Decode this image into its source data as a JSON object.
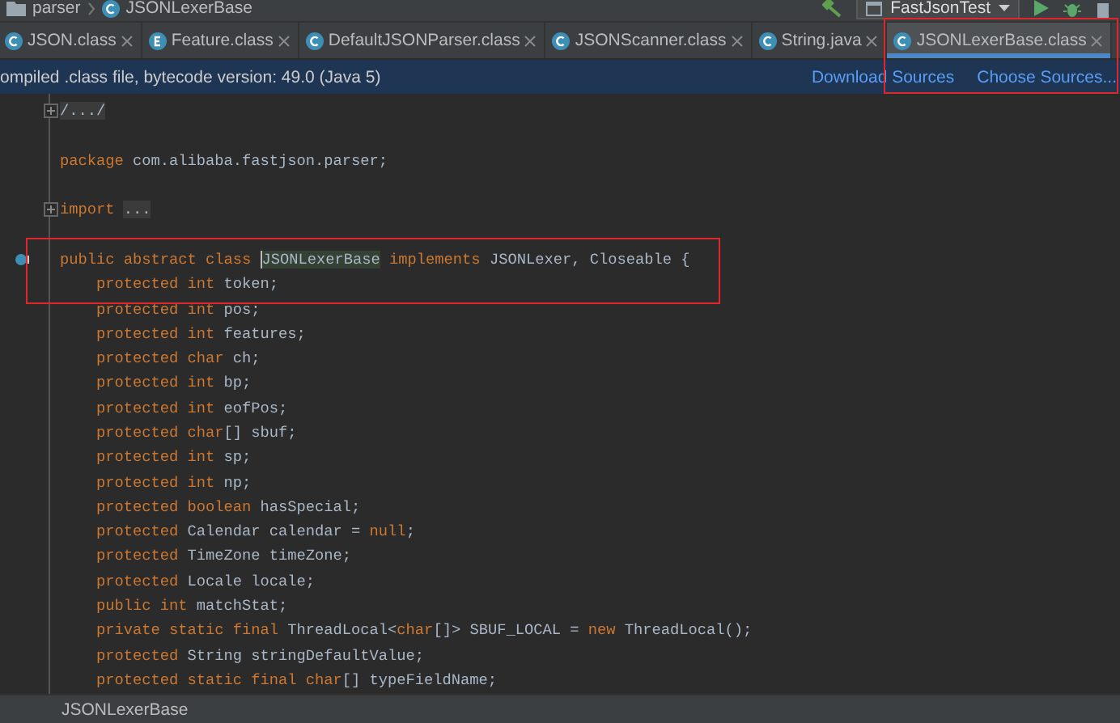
{
  "breadcrumb": [
    {
      "kind": "folder",
      "label": "parser"
    },
    {
      "kind": "class",
      "label": "JSONLexerBase"
    }
  ],
  "run_config": {
    "label": "FastJsonTest"
  },
  "tabs": [
    {
      "label": "JSON.class",
      "kind": "class",
      "selected": false,
      "boxed": false
    },
    {
      "label": "Feature.class",
      "kind": "enum",
      "selected": false,
      "boxed": false
    },
    {
      "label": "DefaultJSONParser.class",
      "kind": "class",
      "selected": false,
      "boxed": false
    },
    {
      "label": "JSONScanner.class",
      "kind": "class",
      "selected": false,
      "boxed": false
    },
    {
      "label": "String.java",
      "kind": "class",
      "selected": false,
      "boxed": false
    },
    {
      "label": "JSONLexerBase.class",
      "kind": "class",
      "selected": true,
      "boxed": true
    }
  ],
  "banner": {
    "text": "ompiled .class file, bytecode version: 49.0 (Java 5)",
    "links": [
      "Download Sources",
      "Choose Sources..."
    ]
  },
  "code_lines": [
    {
      "kind": "code",
      "fold": true,
      "boxed": false,
      "tokens": [
        {
          "text": "/.../",
          "kind": "folded"
        }
      ]
    },
    {
      "kind": "blank"
    },
    {
      "kind": "code",
      "fold": false,
      "boxed": false,
      "tokens": [
        {
          "text": "package",
          "kind": "keyword"
        },
        {
          "text": " com.alibaba.fastjson.parser;",
          "kind": "plain"
        }
      ]
    },
    {
      "kind": "blank"
    },
    {
      "kind": "code",
      "fold": true,
      "boxed": false,
      "tokens": [
        {
          "text": "import ",
          "kind": "keyword"
        },
        {
          "text": "...",
          "kind": "folded"
        }
      ]
    },
    {
      "kind": "blank"
    },
    {
      "kind": "code",
      "fold": false,
      "boxed": true,
      "marker": true,
      "tokens": [
        {
          "text": "public abstract class ",
          "kind": "keyword"
        },
        {
          "text": "JSONLexerBase",
          "kind": "highlight"
        },
        {
          "text": " implements",
          "kind": "keyword"
        },
        {
          "text": " JSONLexer, Closeable {",
          "kind": "plain"
        }
      ]
    },
    {
      "kind": "code",
      "fold": false,
      "boxed": true,
      "tokens": [
        {
          "text": "    protected int",
          "kind": "keyword"
        },
        {
          "text": " token;",
          "kind": "plain"
        }
      ]
    },
    {
      "kind": "code",
      "fold": false,
      "boxed": false,
      "tokens": [
        {
          "text": "    protected int",
          "kind": "keyword"
        },
        {
          "text": " pos;",
          "kind": "plain"
        }
      ]
    },
    {
      "kind": "code",
      "fold": false,
      "boxed": false,
      "tokens": [
        {
          "text": "    protected int",
          "kind": "keyword"
        },
        {
          "text": " features;",
          "kind": "plain"
        }
      ]
    },
    {
      "kind": "code",
      "fold": false,
      "boxed": false,
      "tokens": [
        {
          "text": "    protected char",
          "kind": "keyword"
        },
        {
          "text": " ch;",
          "kind": "plain"
        }
      ]
    },
    {
      "kind": "code",
      "fold": false,
      "boxed": false,
      "tokens": [
        {
          "text": "    protected int",
          "kind": "keyword"
        },
        {
          "text": " bp;",
          "kind": "plain"
        }
      ]
    },
    {
      "kind": "code",
      "fold": false,
      "boxed": false,
      "tokens": [
        {
          "text": "    protected int",
          "kind": "keyword"
        },
        {
          "text": " eofPos;",
          "kind": "plain"
        }
      ]
    },
    {
      "kind": "code",
      "fold": false,
      "boxed": false,
      "tokens": [
        {
          "text": "    protected char",
          "kind": "keyword"
        },
        {
          "text": "[] sbuf;",
          "kind": "plain"
        }
      ]
    },
    {
      "kind": "code",
      "fold": false,
      "boxed": false,
      "tokens": [
        {
          "text": "    protected int",
          "kind": "keyword"
        },
        {
          "text": " sp;",
          "kind": "plain"
        }
      ]
    },
    {
      "kind": "code",
      "fold": false,
      "boxed": false,
      "tokens": [
        {
          "text": "    protected int",
          "kind": "keyword"
        },
        {
          "text": " np;",
          "kind": "plain"
        }
      ]
    },
    {
      "kind": "code",
      "fold": false,
      "boxed": false,
      "tokens": [
        {
          "text": "    protected boolean",
          "kind": "keyword"
        },
        {
          "text": " hasSpecial;",
          "kind": "plain"
        }
      ]
    },
    {
      "kind": "code",
      "fold": false,
      "boxed": false,
      "tokens": [
        {
          "text": "    protected",
          "kind": "keyword"
        },
        {
          "text": " Calendar calendar = ",
          "kind": "plain"
        },
        {
          "text": "null",
          "kind": "keyword"
        },
        {
          "text": ";",
          "kind": "plain"
        }
      ]
    },
    {
      "kind": "code",
      "fold": false,
      "boxed": false,
      "tokens": [
        {
          "text": "    protected",
          "kind": "keyword"
        },
        {
          "text": " TimeZone timeZone;",
          "kind": "plain"
        }
      ]
    },
    {
      "kind": "code",
      "fold": false,
      "boxed": false,
      "tokens": [
        {
          "text": "    protected",
          "kind": "keyword"
        },
        {
          "text": " Locale locale;",
          "kind": "plain"
        }
      ]
    },
    {
      "kind": "code",
      "fold": false,
      "boxed": false,
      "tokens": [
        {
          "text": "    public int",
          "kind": "keyword"
        },
        {
          "text": " matchStat;",
          "kind": "plain"
        }
      ]
    },
    {
      "kind": "code",
      "fold": false,
      "boxed": false,
      "tokens": [
        {
          "text": "    private static final",
          "kind": "keyword"
        },
        {
          "text": " ThreadLocal<",
          "kind": "plain"
        },
        {
          "text": "char",
          "kind": "keyword"
        },
        {
          "text": "[]> SBUF_LOCAL = ",
          "kind": "plain"
        },
        {
          "text": "new",
          "kind": "keyword"
        },
        {
          "text": " ThreadLocal();",
          "kind": "plain"
        }
      ]
    },
    {
      "kind": "code",
      "fold": false,
      "boxed": false,
      "tokens": [
        {
          "text": "    protected",
          "kind": "keyword"
        },
        {
          "text": " String stringDefaultValue;",
          "kind": "plain"
        }
      ]
    },
    {
      "kind": "code",
      "fold": false,
      "boxed": false,
      "tokens": [
        {
          "text": "    protected static final char",
          "kind": "keyword"
        },
        {
          "text": "[] typeFieldName;",
          "kind": "plain"
        }
      ]
    }
  ],
  "status_bar": {
    "text": "JSONLexerBase"
  }
}
